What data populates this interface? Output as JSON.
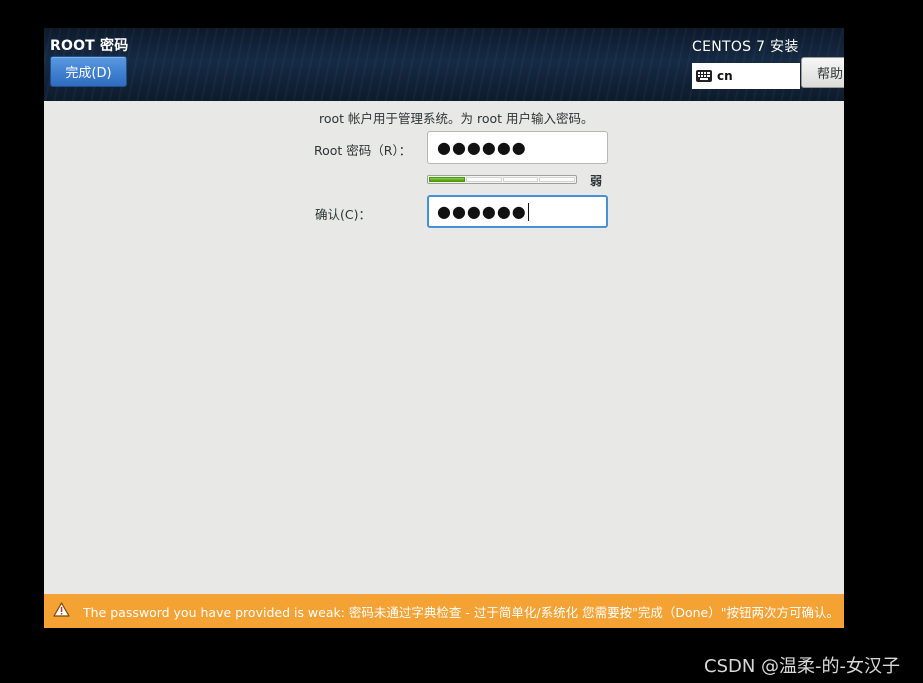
{
  "header": {
    "spoke_title": "ROOT 密码",
    "done_label": "完成(D)",
    "product_title": "CENTOS 7 安装",
    "keyboard_layout": "cn",
    "help_label": "帮助"
  },
  "form": {
    "description": "root 帐户用于管理系统。为 root 用户输入密码。",
    "root_password_label": "Root 密码（R）：",
    "root_password_value": "●●●●●●",
    "strength": {
      "label": "弱",
      "filled_segments": 1,
      "total_segments": 4
    },
    "confirm_label": "确认(C)：",
    "confirm_value": "●●●●●●"
  },
  "warning": {
    "icon": "warning-triangle-icon",
    "text": "The password you have provided is weak: 密码未通过字典检查 - 过于简单化/系统化 您需要按\"完成（Done）\"按钮两次方可确认。"
  },
  "watermark": "CSDN @温柔-的-女汉子",
  "colors": {
    "header_bg": "#152a44",
    "done_button": "#3f7fd0",
    "strength_fill": "#4e9a06",
    "warning_bg": "#f5a234",
    "content_bg": "#e8e8e7"
  }
}
